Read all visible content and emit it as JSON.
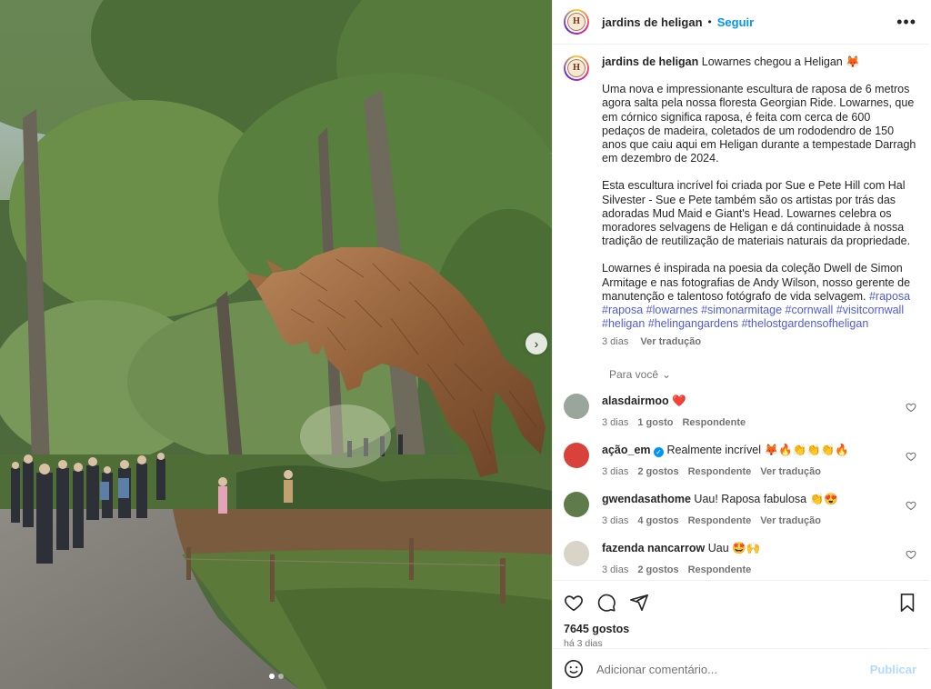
{
  "header": {
    "username": "jardins de heligan",
    "separator": "•",
    "follow_label": "Seguir",
    "more_icon": "more-horizontal-icon"
  },
  "avatar_letter": "H",
  "caption": {
    "username": "jardins de heligan",
    "title": "Lowarnes chegou a Heligan 🦊",
    "paragraph1": "Uma nova e impressionante escultura de raposa de 6 metros agora salta pela nossa floresta Georgian Ride. Lowarnes, que em córnico significa raposa, é feita com cerca de 600 pedaços de madeira, coletados de um rododendro de 150 anos que caiu aqui em Heligan durante a tempestade Darragh em dezembro de 2024.",
    "paragraph2": "Esta escultura incrível foi criada por Sue e Pete Hill com Hal Silvester - Sue e Pete também são os artistas por trás das adoradas Mud Maid e Giant's Head. Lowarnes celebra os moradores selvagens de Heligan e dá continuidade à nossa tradição de reutilização de materiais naturais da propriedade.",
    "paragraph3": "Lowarnes é inspirada na poesia da coleção Dwell de Simon Armitage e nas fotografias de Andy Wilson, nosso gerente de manutenção e talentoso fotógrafo de vida selvagem.",
    "hashtags": "#raposa #raposa #lowarnes #simonarmitage #cornwall #visitcornwall #heligan #helingangardens #thelostgardensofheligan",
    "time": "3 dias",
    "translate": "Ver tradução"
  },
  "for_you": "Para você",
  "comments": [
    {
      "username": "alasdairmoo",
      "text": "❤️",
      "time": "3 dias",
      "likes": "1 gosto",
      "reply": "Respondente",
      "translate": "",
      "verified": false,
      "avatar_color": "#9aa59b"
    },
    {
      "username": "ação_em",
      "text": "Realmente incrível 🦊🔥👏👏👏🔥",
      "time": "3 dias",
      "likes": "2 gostos",
      "reply": "Respondente",
      "translate": "Ver tradução",
      "verified": true,
      "avatar_color": "#d8423a"
    },
    {
      "username": "gwendasathome",
      "text": "Uau! Raposa fabulosa 👏😍",
      "time": "3 dias",
      "likes": "4 gostos",
      "reply": "Respondente",
      "translate": "Ver tradução",
      "verified": false,
      "avatar_color": "#5f7b4a"
    },
    {
      "username": "fazenda nancarrow",
      "text": "Uau 🤩🙌",
      "time": "3 dias",
      "likes": "2 gostos",
      "reply": "Respondente",
      "translate": "",
      "verified": false,
      "avatar_color": "#d9d4c8"
    }
  ],
  "actions": {
    "likes": "7645 gostos",
    "ago": "há 3 dias"
  },
  "comment_box": {
    "placeholder": "Adicionar comentário...",
    "publish": "Publicar"
  },
  "carousel": {
    "current_slide": 1,
    "total_slides": 2
  }
}
